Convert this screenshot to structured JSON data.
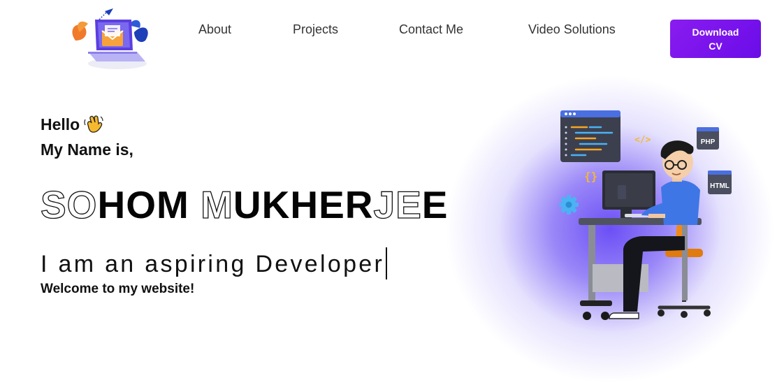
{
  "nav": {
    "links": [
      {
        "label": "About"
      },
      {
        "label": "Projects"
      },
      {
        "label": "Contact Me"
      },
      {
        "label": "Video Solutions"
      }
    ],
    "cta_label": "Download CV"
  },
  "hero": {
    "greeting": "Hello",
    "name_intro": "My Name is,",
    "name_parts": [
      "SO",
      "HOM",
      "M",
      "U",
      "KHER",
      "JE",
      "E"
    ],
    "typed_text": "I am an aspiring Developer",
    "welcome": "Welcome to my website!"
  },
  "illustration": {
    "badges": {
      "php": "PHP",
      "html": "HTML",
      "code": "</>",
      "braces": "{}"
    }
  },
  "colors": {
    "accent": "#7b12f0",
    "glow": "#6a4df3"
  },
  "icons": [
    "email-laptop-logo",
    "waving-hand-icon",
    "developer-at-desk-illustration"
  ]
}
